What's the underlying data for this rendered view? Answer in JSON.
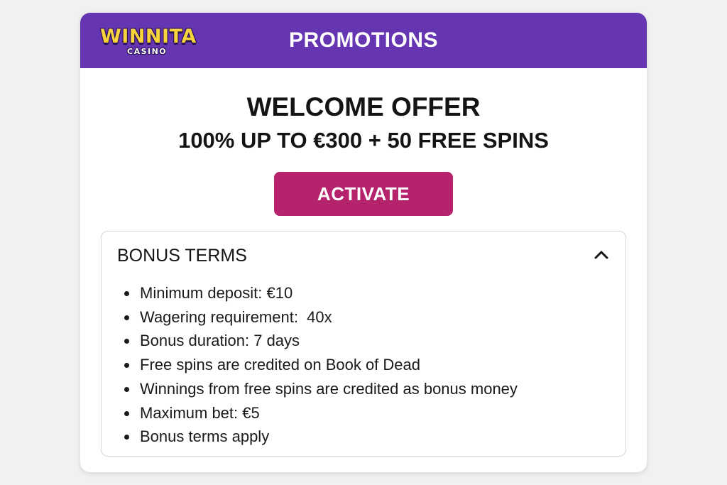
{
  "header": {
    "logo": {
      "main": "WINNITA",
      "sub": "CASINO"
    },
    "title": "PROMOTIONS"
  },
  "offer": {
    "title": "WELCOME OFFER",
    "subtitle": "100% UP TO €300 + 50 FREE SPINS",
    "activate_label": "ACTIVATE"
  },
  "terms": {
    "title": "BONUS TERMS",
    "expanded": true,
    "toggle_icon": "chevron-up-icon",
    "items": [
      "Minimum deposit: €10",
      "Wagering requirement:  40x",
      "Bonus duration: 7 days",
      "Free spins are credited on Book of Dead",
      "Winnings from free spins are credited as bonus money",
      "Maximum bet: €5",
      "Bonus terms apply"
    ]
  },
  "colors": {
    "header_bg": "#6535b2",
    "logo_yellow": "#f7d33c",
    "activate_bg": "#b4236c",
    "page_bg": "#f1f1f2"
  }
}
